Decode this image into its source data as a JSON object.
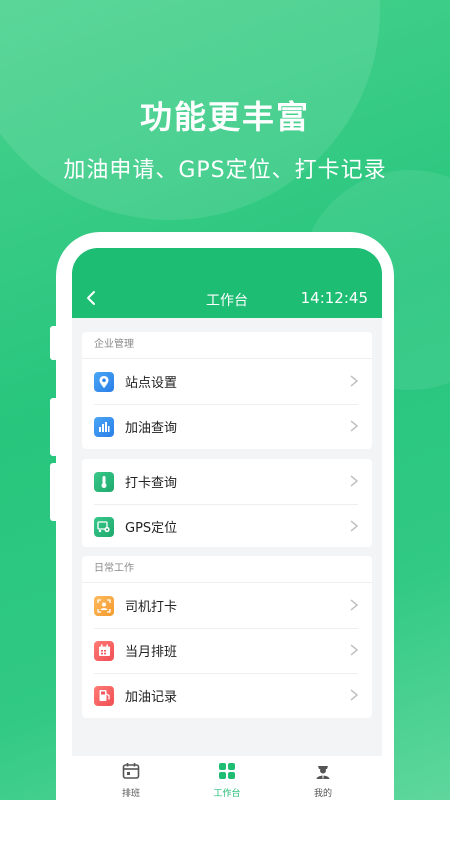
{
  "promo": {
    "headline": "功能更丰富",
    "subline": "加油申请、GPS定位、打卡记录"
  },
  "app": {
    "title": "工作台",
    "time": "14:12:45",
    "accent": "#1ebd74"
  },
  "sections": {
    "enterprise": {
      "label": "企业管理",
      "items": [
        {
          "label": "站点设置",
          "icon": "location-pin-icon"
        },
        {
          "label": "加油查询",
          "icon": "bar-chart-icon"
        }
      ]
    },
    "checkin": {
      "items": [
        {
          "label": "打卡查询",
          "icon": "thermometer-icon"
        },
        {
          "label": "GPS定位",
          "icon": "vehicle-gps-icon"
        }
      ]
    },
    "daily": {
      "label": "日常工作",
      "items": [
        {
          "label": "司机打卡",
          "icon": "face-scan-icon"
        },
        {
          "label": "当月排班",
          "icon": "calendar-icon"
        },
        {
          "label": "加油记录",
          "icon": "fuel-pump-icon"
        }
      ]
    }
  },
  "tabbar": {
    "tabs": [
      {
        "label": "排班",
        "icon": "schedule-icon",
        "active": false
      },
      {
        "label": "工作台",
        "icon": "grid-icon",
        "active": true
      },
      {
        "label": "我的",
        "icon": "driver-profile-icon",
        "active": false
      }
    ],
    "active_color": "#1ebd74",
    "inactive_color": "#555555"
  }
}
